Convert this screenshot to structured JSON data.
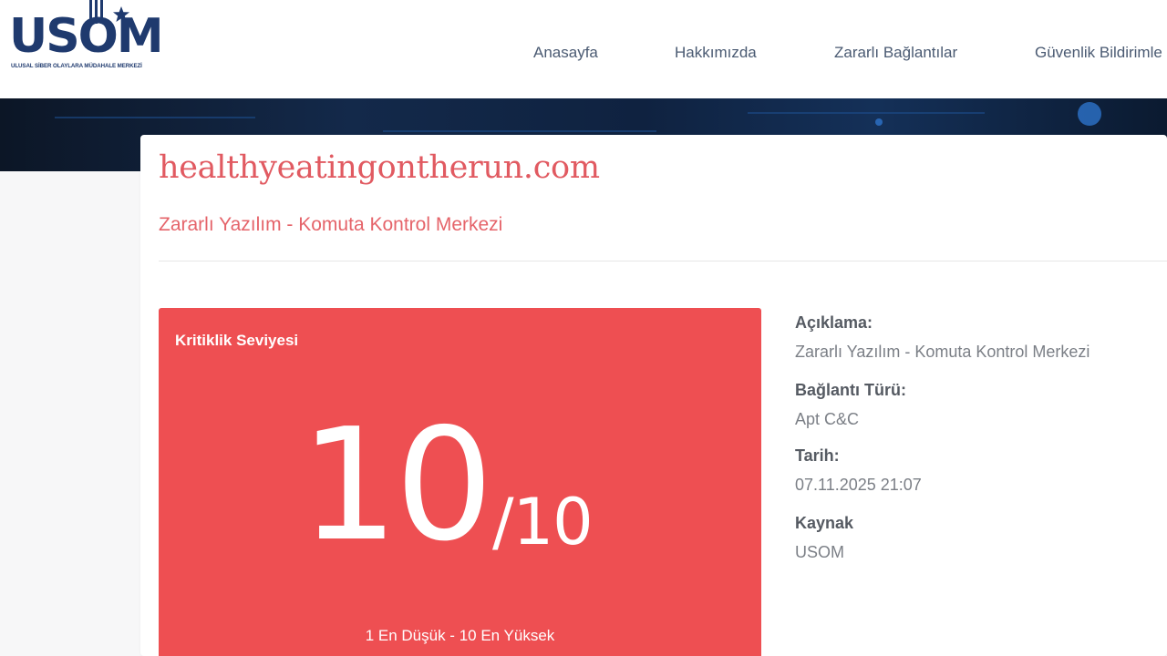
{
  "logo": {
    "text": "USOM",
    "subtitle": "ULUSAL SİBER OLAYLARA MÜDAHALE MERKEZİ"
  },
  "nav": {
    "items": [
      "Anasayfa",
      "Hakkımızda",
      "Zararlı Bağlantılar",
      "Güvenlik Bildirimle"
    ]
  },
  "record": {
    "domain": "healthyeatingontherun.com",
    "category": "Zararlı Yazılım - Komuta Kontrol Merkezi"
  },
  "criticality": {
    "title": "Kritiklik Seviyesi",
    "value": "10",
    "max": "/10",
    "scale_note": "1 En Düşük - 10 En Yüksek",
    "color": "#ee4f52"
  },
  "details": [
    {
      "label": "Açıklama:",
      "value": "Zararlı Yazılım - Komuta Kontrol Merkezi"
    },
    {
      "label": "Bağlantı Türü:",
      "value": "Apt C&C"
    },
    {
      "label": "Tarih:",
      "value": "07.11.2025 21:07"
    },
    {
      "label": "Kaynak",
      "value": "USOM"
    }
  ],
  "colors": {
    "brand": "#1f3a6e",
    "accent": "#e15a61",
    "nav_text": "#4a5a72"
  }
}
